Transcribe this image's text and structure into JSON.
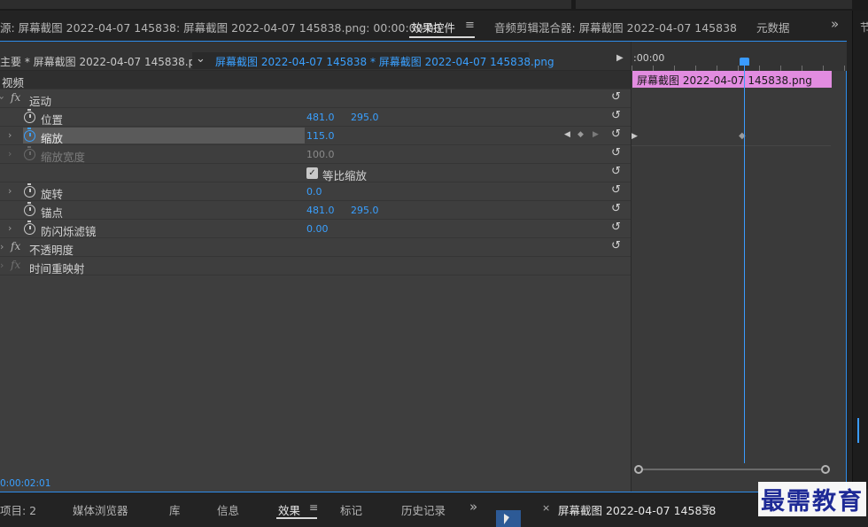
{
  "top_tabs": {
    "source": "源: 屏幕截图 2022-04-07  145838: 屏幕截图 2022-04-07  145838.png: 00:00:00:00",
    "effect_controls": "效果控件",
    "menu_glyph": "≡",
    "audio_mixer": "音频剪辑混合器: 屏幕截图 2022-04-07  145838",
    "metadata": "元数据",
    "overflow": "»"
  },
  "subheader": {
    "master_clip": "主要 * 屏幕截图 2022-04-07  145838.png",
    "dropdown_glyph": "⌄",
    "active_clip": "屏幕截图 2022-04-07  145838 * 屏幕截图 2022-04-07  145838.png",
    "play_glyph": "▶"
  },
  "section": {
    "video_label": "视频"
  },
  "effects": [
    {
      "label": "运动"
    },
    {
      "label": "不透明度"
    },
    {
      "label": "时间重映射"
    }
  ],
  "params": {
    "position": {
      "label": "位置",
      "x": "481.0",
      "y": "295.0"
    },
    "scale": {
      "label": "缩放",
      "value": "115.0"
    },
    "scale_width": {
      "label": "缩放宽度",
      "value": "100.0"
    },
    "uniform_scale": {
      "label": "等比缩放",
      "checked": true
    },
    "rotation": {
      "label": "旋转",
      "value": "0.0"
    },
    "anchor": {
      "label": "锚点",
      "x": "481.0",
      "y": "295.0"
    },
    "anti_flicker": {
      "label": "防闪烁滤镜",
      "value": "0.00"
    }
  },
  "icons": {
    "fx": "fx",
    "reset": "↺",
    "chevron": "›",
    "keyframe_prev": "◀",
    "keyframe_add": "◆",
    "keyframe_next": "▶",
    "checkmark": "✓"
  },
  "timeline": {
    "ruler_time": ":00:00",
    "clip_label": "屏幕截图 2022-04-07  145838.png"
  },
  "current_timecode": "0:00:02:01",
  "bottom_tabs": {
    "project": "项目: 2",
    "media_browser": "媒体浏览器",
    "library": "库",
    "info": "信息",
    "effects": "效果",
    "effects_menu": "≡",
    "markers": "标记",
    "history": "历史记录",
    "overflow": "»",
    "close": "×",
    "sequence": "屏幕截图 2022-04-07  145838",
    "sequence_menu": "≡"
  },
  "right_panel_glyph": "节",
  "watermark": "最需教育",
  "colors": {
    "accent_blue": "#3aa0ff",
    "clip_pink": "#e28ce0",
    "panel_bg": "#3e3e3e",
    "watermark": "#1e2a96"
  }
}
